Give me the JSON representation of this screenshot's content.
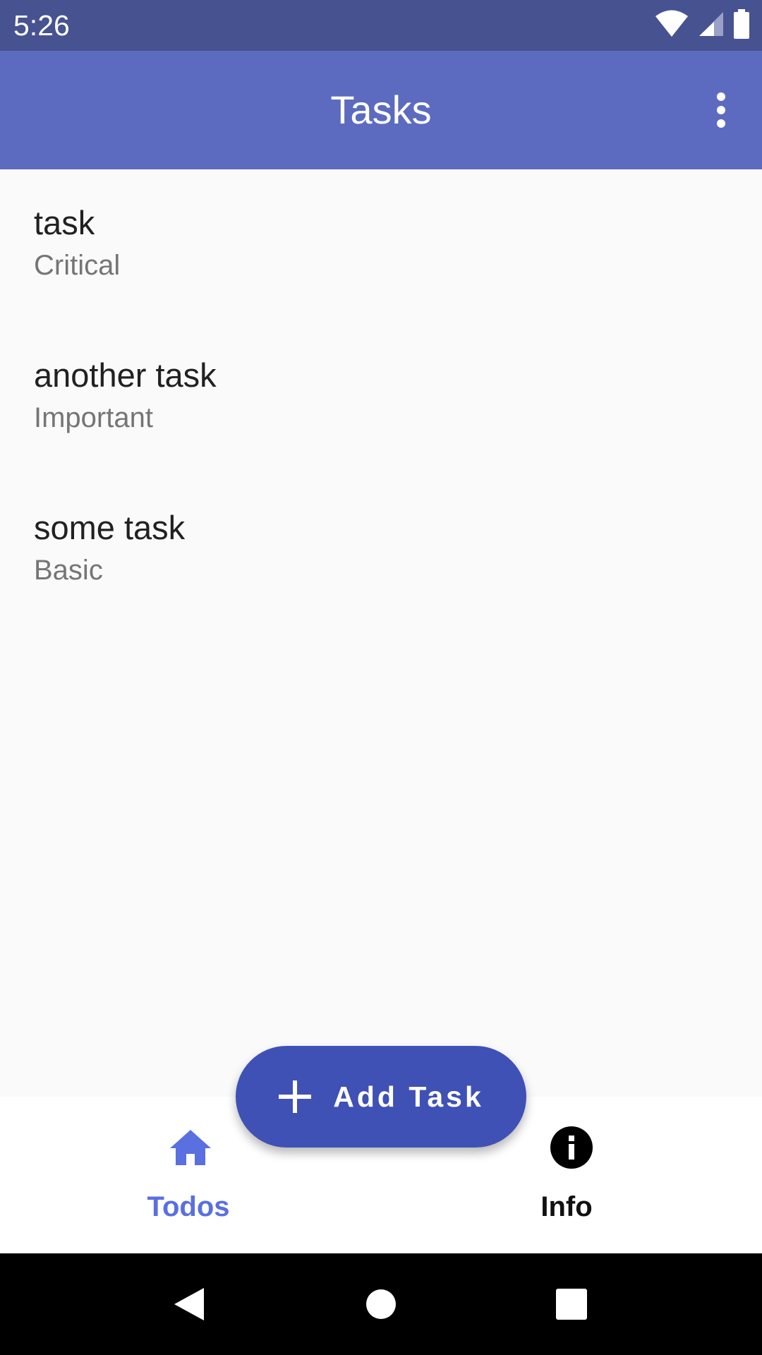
{
  "status_bar": {
    "time": "5:26",
    "icons": [
      "wifi-icon",
      "cellular-signal-icon",
      "battery-icon"
    ]
  },
  "app_bar": {
    "title": "Tasks",
    "menu_icon": "more-vert-icon"
  },
  "tasks": [
    {
      "title": "task",
      "priority": "Critical"
    },
    {
      "title": "another task",
      "priority": "Important"
    },
    {
      "title": "some task",
      "priority": "Basic"
    }
  ],
  "fab": {
    "icon": "plus-icon",
    "label": "Add Task"
  },
  "bottom_nav": {
    "items": [
      {
        "label": "Todos",
        "icon": "home-icon",
        "selected": true
      },
      {
        "label": "Info",
        "icon": "info-icon",
        "selected": false
      }
    ]
  },
  "system_nav": {
    "icons": [
      "back-icon",
      "home-circle-icon",
      "recents-icon"
    ]
  },
  "colors": {
    "status_bar": "#475290",
    "app_bar": "#5c6bc0",
    "fab": "#3f51b5",
    "nav_active": "#5a6fe0",
    "background": "#fafafa"
  }
}
